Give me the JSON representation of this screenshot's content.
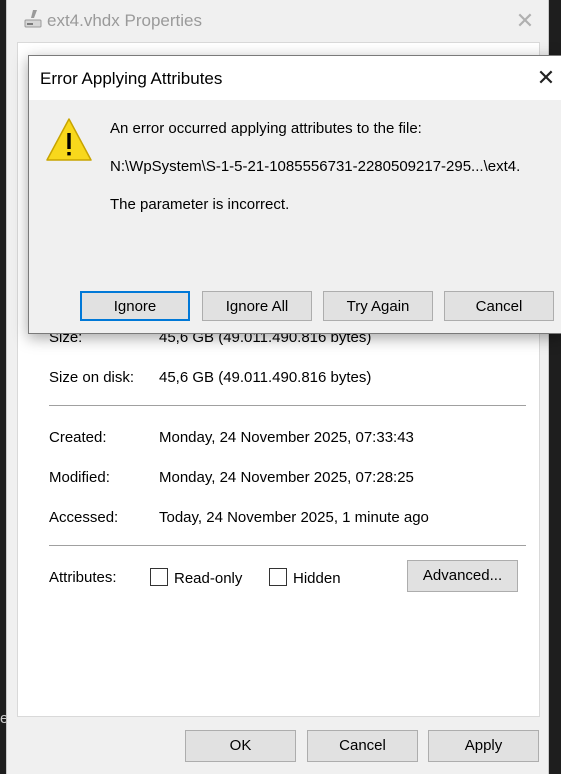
{
  "props_window": {
    "title": "ext4.vhdx Properties",
    "details": {
      "size_label": "Size:",
      "size_value": "45,6 GB (49.011.490.816 bytes)",
      "size_on_disk_label": "Size on disk:",
      "size_on_disk_value": "45,6 GB (49.011.490.816 bytes)",
      "created_label": "Created:",
      "created_value": "Monday, 24 November 2025, 07:33:43",
      "modified_label": "Modified:",
      "modified_value": "Monday, 24 November 2025, 07:28:25",
      "accessed_label": "Accessed:",
      "accessed_value": "Today, 24 November 2025, 1 minute ago"
    },
    "attributes": {
      "label": "Attributes:",
      "readonly_label": "Read-only",
      "hidden_label": "Hidden",
      "advanced_label": "Advanced..."
    },
    "buttons": {
      "ok": "OK",
      "cancel": "Cancel",
      "apply": "Apply"
    }
  },
  "error_dialog": {
    "title": "Error Applying Attributes",
    "message_line1": "An error occurred applying attributes to the file:",
    "path": "N:\\WpSystem\\S-1-5-21-1085556731-2280509217-295...\\ext4.",
    "message_line2": "The parameter is incorrect.",
    "buttons": {
      "ignore": "Ignore",
      "ignore_all": "Ignore All",
      "try_again": "Try Again",
      "cancel": "Cancel"
    }
  },
  "background": {
    "left_char": "e"
  },
  "colors": {
    "accent": "#0078d7",
    "warning_yellow": "#f8d81c"
  },
  "icons": {
    "props_title_icon": "drive-icon",
    "warning": "warning-icon",
    "close": "close-icon"
  }
}
